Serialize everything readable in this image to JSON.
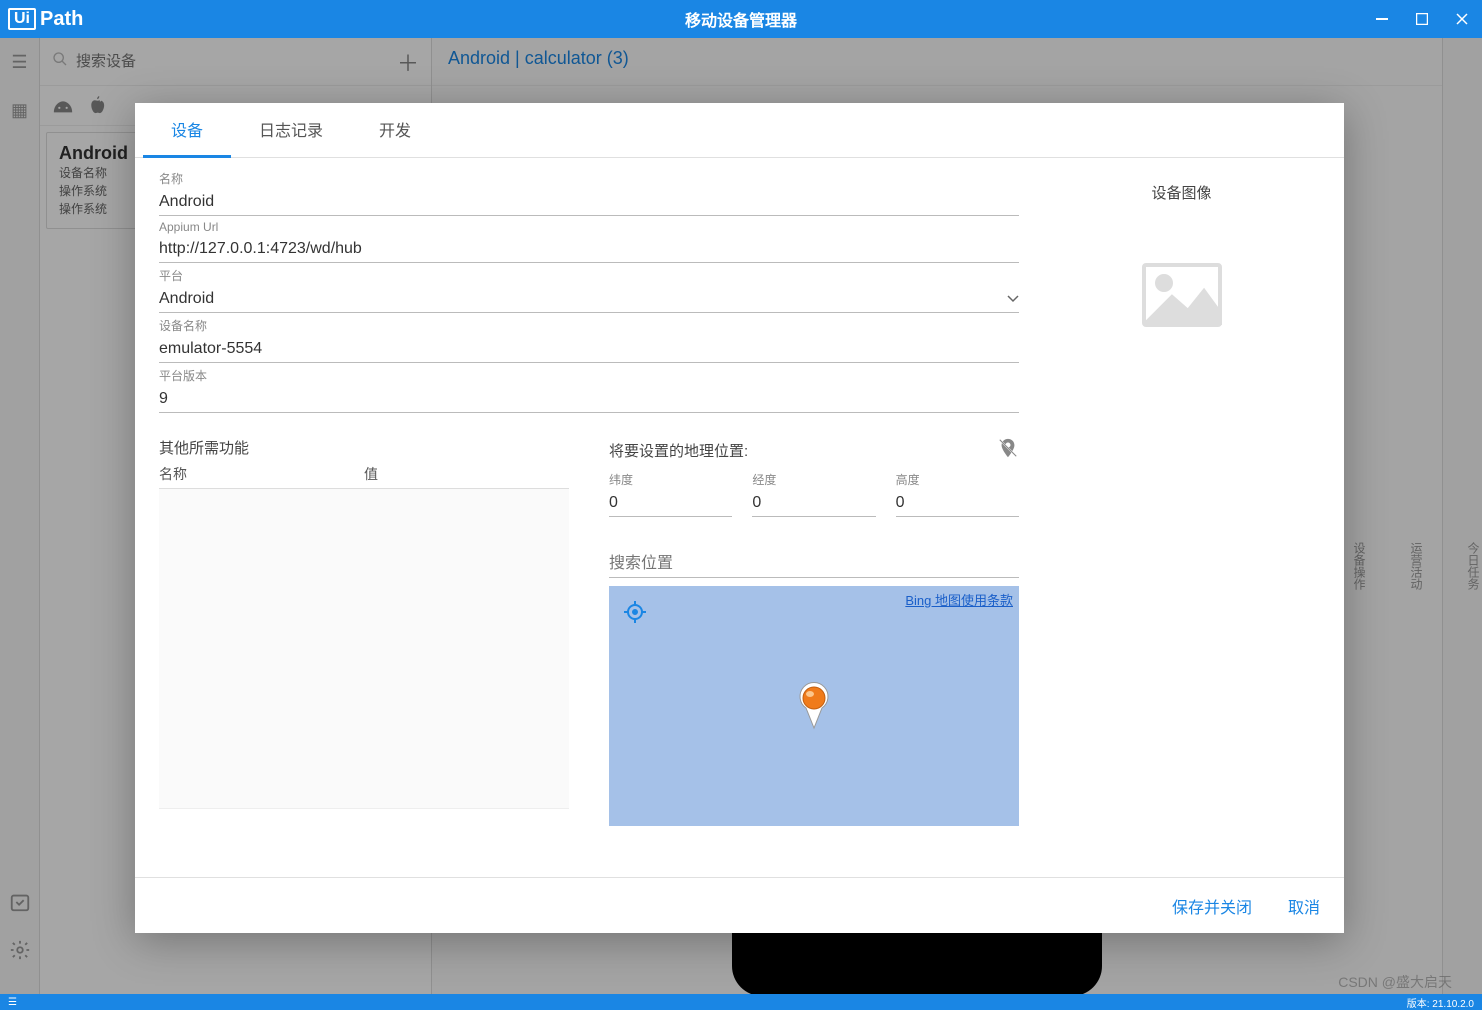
{
  "titlebar": {
    "logo_ui": "Ui",
    "logo_path": "Path",
    "title": "移动设备管理器"
  },
  "device_panel": {
    "search_placeholder": "搜索设备",
    "card": {
      "title": "Android",
      "line1": "设备名称",
      "line2": "操作系统",
      "line3": "操作系统"
    }
  },
  "content_header": "Android | calculator (3)",
  "right_rail": {
    "i1": "今日任务",
    "i2": "运营活动",
    "i3": "设备操作"
  },
  "modal": {
    "tabs": {
      "device": "设备",
      "log": "日志记录",
      "dev": "开发"
    },
    "fields": {
      "name_label": "名称",
      "name_value": "Android",
      "appium_label": "Appium Url",
      "appium_value": "http://127.0.0.1:4723/wd/hub",
      "platform_label": "平台",
      "platform_value": "Android",
      "devname_label": "设备名称",
      "devname_value": "emulator-5554",
      "platver_label": "平台版本",
      "platver_value": "9"
    },
    "caps": {
      "title": "其他所需功能",
      "col_name": "名称",
      "col_value": "值"
    },
    "geo": {
      "title": "将要设置的地理位置:",
      "lat_label": "纬度",
      "lat_value": "0",
      "lon_label": "经度",
      "lon_value": "0",
      "alt_label": "高度",
      "alt_value": "0",
      "search_placeholder": "搜索位置",
      "map_link": "Bing 地图使用条款"
    },
    "side": {
      "title": "设备图像"
    },
    "footer": {
      "save": "保存并关闭",
      "cancel": "取消"
    }
  },
  "bottom": {
    "version": "版本: 21.10.2.0"
  },
  "watermark": "CSDN @盛大启天"
}
